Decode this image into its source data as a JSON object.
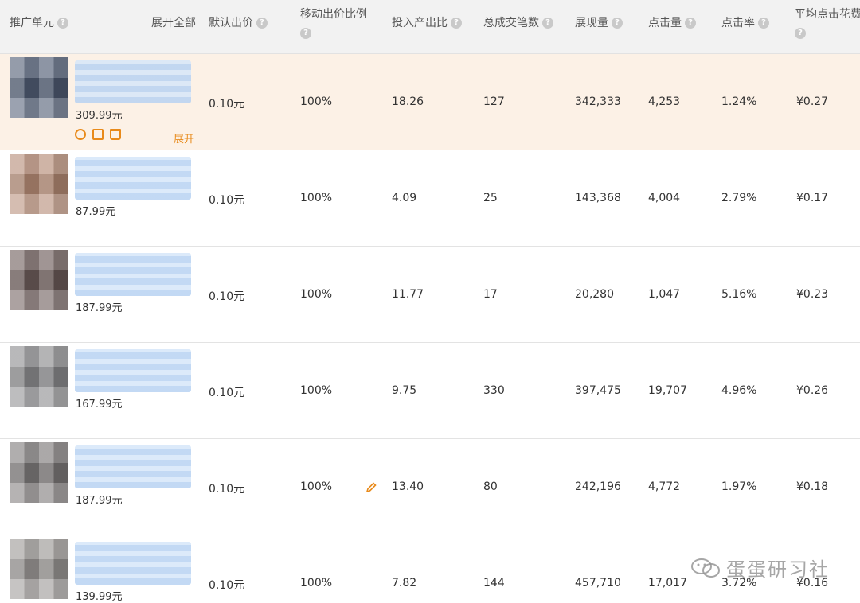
{
  "header": {
    "unit": "推广单元",
    "expand_all": "展开全部",
    "default_bid": "默认出价",
    "mobile_ratio": "移动出价比例",
    "roi": "投入产出比",
    "orders": "总成交笔数",
    "impressions": "展现量",
    "clicks": "点击量",
    "ctr": "点击率",
    "avg_cpc": "平均点击花费",
    "help_glyph": "?"
  },
  "icons": {
    "help": "question-circle-icon",
    "pause": "pause-icon",
    "copy": "copy-icon",
    "delete": "trash-icon",
    "edit": "pencil-icon"
  },
  "colors": {
    "accent": "#e88a1a",
    "active_row_bg": "#fcf1e6",
    "header_bg": "#f2f2f2",
    "blur_blue": "#b8d2f2"
  },
  "rows": [
    {
      "price": "309.99元",
      "default_bid": "0.10元",
      "mobile_ratio": "100%",
      "roi": "18.26",
      "orders": "127",
      "impressions": "342,333",
      "clicks": "4,253",
      "ctr": "1.24%",
      "avg_cpc": "¥0.27",
      "expand": "展开",
      "thumb_color": "#4e5a72"
    },
    {
      "price": "87.99元",
      "default_bid": "0.10元",
      "mobile_ratio": "100%",
      "roi": "4.09",
      "orders": "25",
      "impressions": "143,368",
      "clicks": "4,004",
      "ctr": "2.79%",
      "avg_cpc": "¥0.17",
      "thumb_color": "#b48a74"
    },
    {
      "price": "187.99元",
      "default_bid": "0.10元",
      "mobile_ratio": "100%",
      "roi": "11.77",
      "orders": "17",
      "impressions": "20,280",
      "clicks": "1,047",
      "ctr": "5.16%",
      "avg_cpc": "¥0.23",
      "thumb_color": "#6b5a58"
    },
    {
      "price": "167.99元",
      "default_bid": "0.10元",
      "mobile_ratio": "100%",
      "roi": "9.75",
      "orders": "330",
      "impressions": "397,475",
      "clicks": "19,707",
      "ctr": "4.96%",
      "avg_cpc": "¥0.26",
      "thumb_color": "#8a8a8c"
    },
    {
      "price": "187.99元",
      "default_bid": "0.10元",
      "mobile_ratio": "100%",
      "roi": "13.40",
      "orders": "80",
      "impressions": "242,196",
      "clicks": "4,772",
      "ctr": "1.97%",
      "avg_cpc": "¥0.18",
      "thumb_color": "#7c7878"
    },
    {
      "price": "139.99元",
      "default_bid": "0.10元",
      "mobile_ratio": "100%",
      "roi": "7.82",
      "orders": "144",
      "impressions": "457,710",
      "clicks": "17,017",
      "ctr": "3.72%",
      "avg_cpc": "¥0.16",
      "thumb_color": "#9a9694"
    }
  ],
  "watermark": "蛋蛋研习社"
}
